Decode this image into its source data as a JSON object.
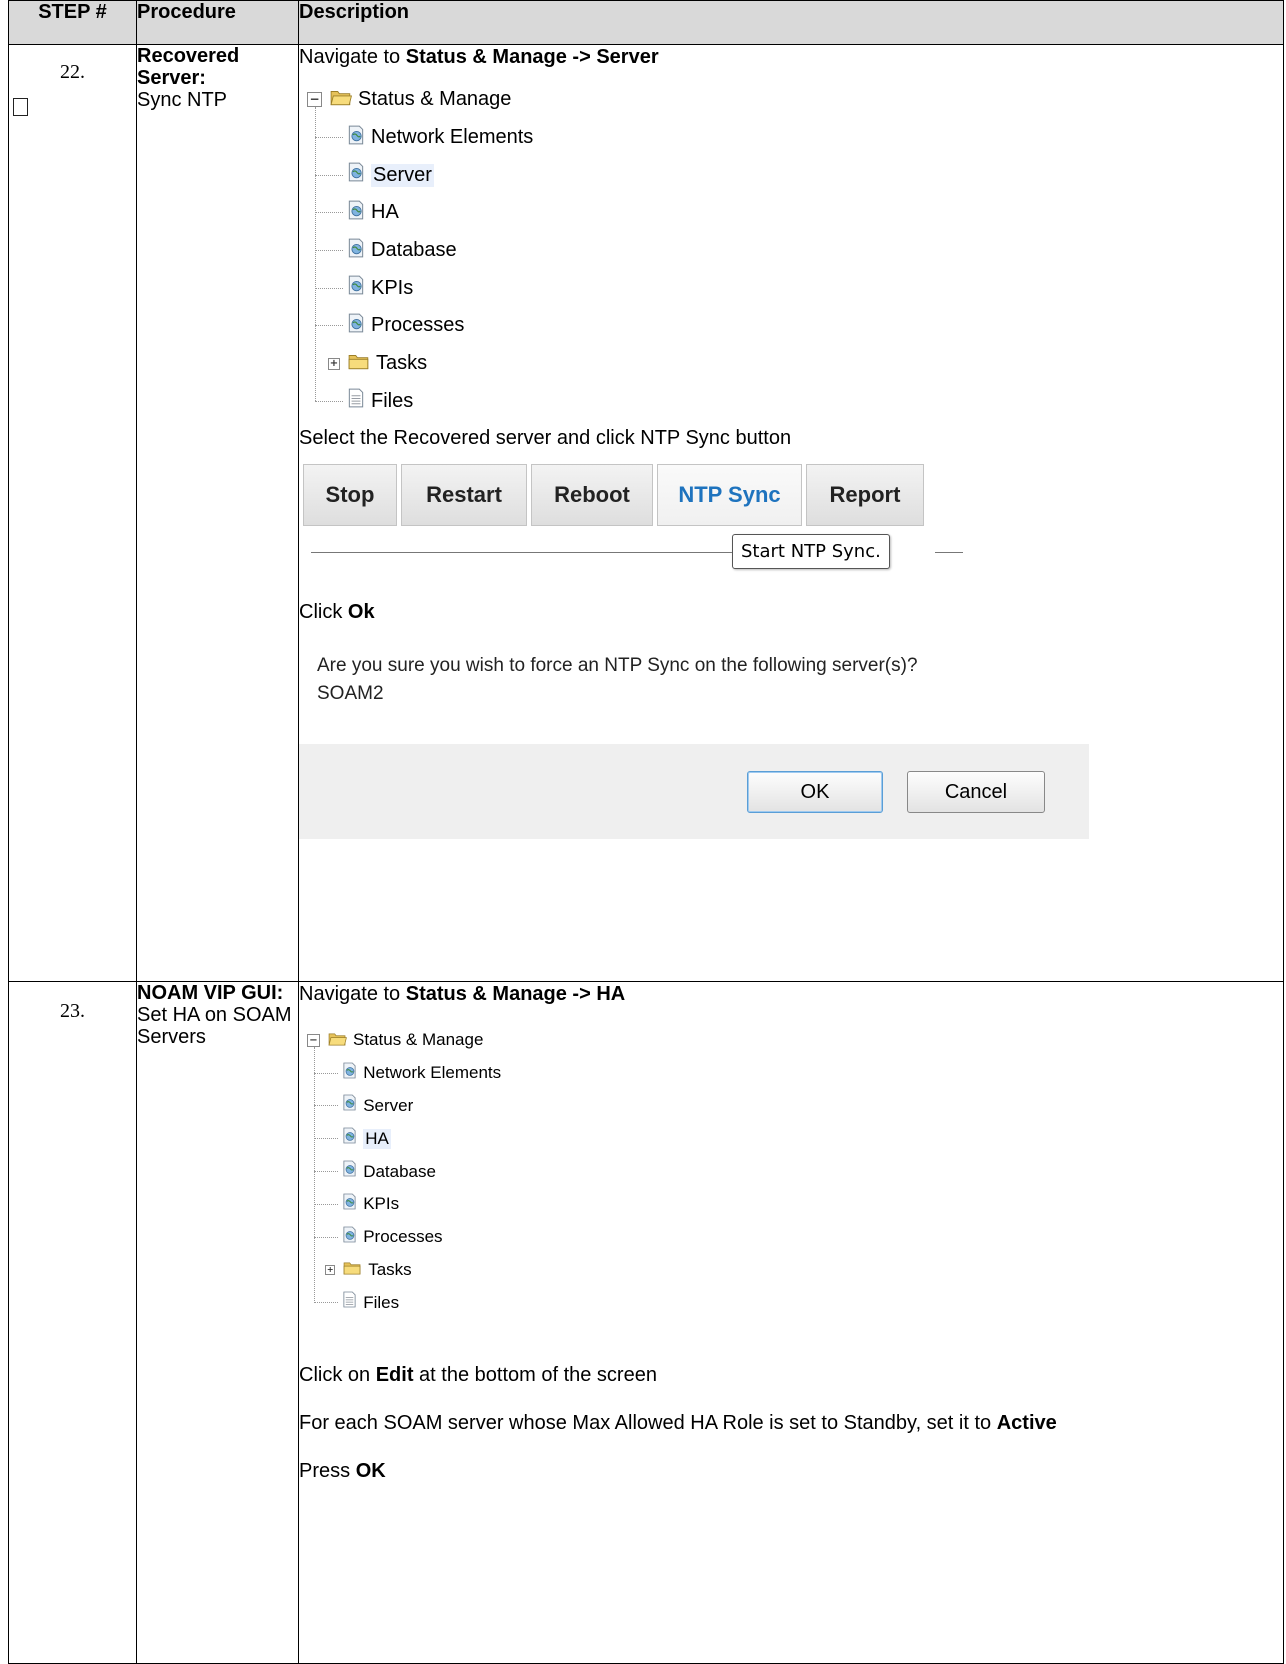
{
  "header": {
    "step": "STEP #",
    "procedure": "Procedure",
    "description": "Description"
  },
  "steps": [
    {
      "number": "22.",
      "procedure_title": "Recovered Server:",
      "procedure_rest": "Sync NTP",
      "navigate_prefix": "Navigate to ",
      "navigate_target": "Status & Manage -> Server",
      "tree": {
        "root": "Status & Manage",
        "items": [
          "Network Elements",
          "Server",
          "HA",
          "Database",
          "KPIs",
          "Processes",
          "Tasks",
          "Files"
        ],
        "selected": "Server"
      },
      "select_text": "Select the Recovered server and click NTP Sync button",
      "buttons": [
        "Stop",
        "Restart",
        "Reboot",
        "NTP Sync",
        "Report"
      ],
      "active_button": "NTP Sync",
      "tooltip": "Start NTP Sync.",
      "click_prefix": "Click ",
      "click_target": "Ok",
      "dialog": {
        "message": "Are you sure you wish to force an NTP Sync on the following server(s)?",
        "server": "SOAM2",
        "ok": "OK",
        "cancel": "Cancel"
      }
    },
    {
      "number": "23.",
      "procedure_title": "NOAM VIP GUI:",
      "procedure_rest": "Set HA on SOAM Servers",
      "navigate_prefix": "Navigate to ",
      "navigate_target": "Status & Manage -> HA",
      "tree": {
        "root": "Status & Manage",
        "items": [
          "Network Elements",
          "Server",
          "HA",
          "Database",
          "KPIs",
          "Processes",
          "Tasks",
          "Files"
        ],
        "selected": "HA"
      },
      "edit_prefix": "Click on ",
      "edit_target": "Edit",
      "edit_suffix": " at the bottom of the screen",
      "each_text": "For each SOAM server whose Max Allowed HA Role is set to Standby, set it to ",
      "each_target": "Active",
      "press_prefix": "Press ",
      "press_target": "OK"
    }
  ],
  "colors": {
    "header_bg": "#d9d9d9",
    "active_button_text": "#1e73be",
    "dialog_footer_bg": "#efefef",
    "folder": "#f3d46b"
  }
}
